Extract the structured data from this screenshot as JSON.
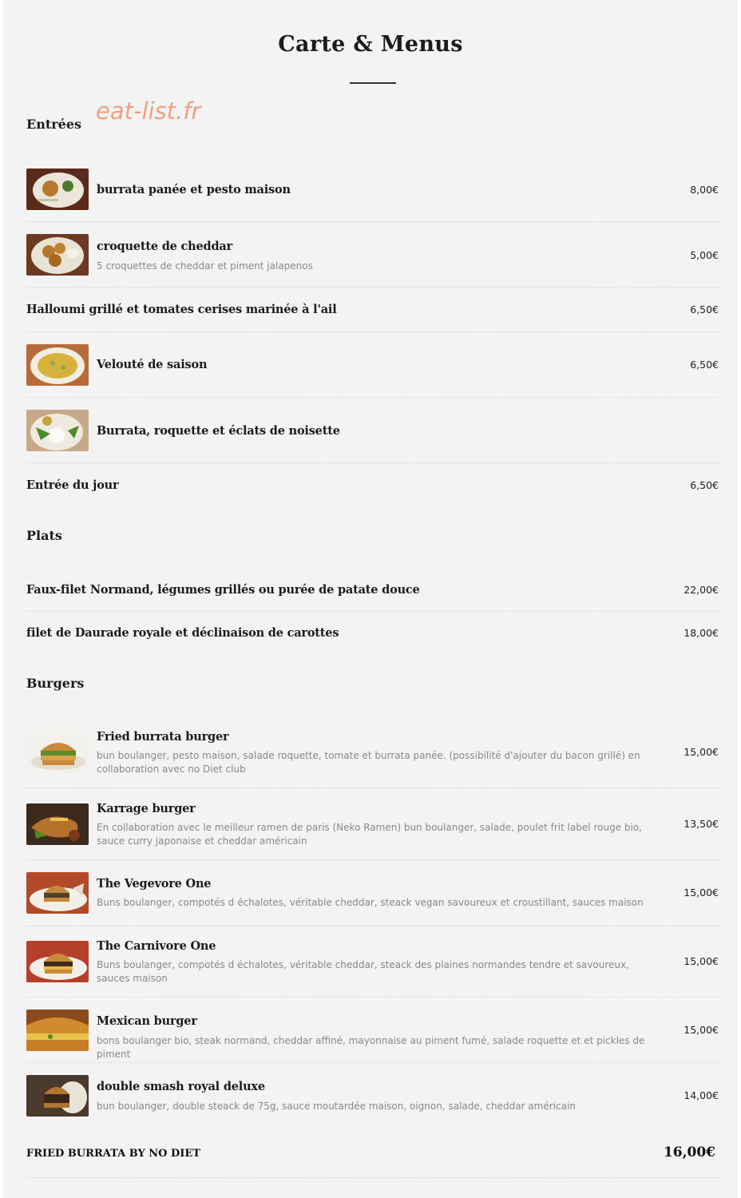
{
  "header": {
    "title": "Carte & Menus",
    "watermark": "eat-list.fr"
  },
  "sections": {
    "entrees": {
      "title": "Entrées",
      "items": [
        {
          "name": "burrata panée et pesto maison",
          "price": "8,00€",
          "image": "burrata-pesto-photo"
        },
        {
          "name": "croquette de cheddar",
          "description": "5 croquettes de cheddar et piment jalapenos",
          "price": "5,00€",
          "image": "cheddar-croquettes-photo"
        },
        {
          "name": "Halloumi grillé et tomates cerises marinée à l'ail",
          "price": "6,50€"
        },
        {
          "name": "Velouté de saison",
          "price": "6,50€",
          "image": "veloute-soup-photo"
        },
        {
          "name": "Burrata, roquette et éclats de noisette",
          "price": "",
          "image": "burrata-roquette-photo"
        },
        {
          "name": "Entrée du jour",
          "price": "6,50€"
        }
      ]
    },
    "plats": {
      "title": "Plats",
      "items": [
        {
          "name": "Faux-filet Normand, légumes grillés ou purée de patate douce",
          "price": "22,00€"
        },
        {
          "name": "filet de Daurade royale et déclinaison de carottes",
          "price": "18,00€"
        }
      ]
    },
    "burgers": {
      "title": "Burgers",
      "items": [
        {
          "name": "Fried burrata burger",
          "description": "bun boulanger, pesto maison, salade roquette, tomate et burrata panée. (possibilité d'ajouter du bacon grillé) en collaboration avec no Diet club",
          "price": "15,00€",
          "image": "fried-burrata-burger-photo"
        },
        {
          "name": "Karrage burger",
          "description": "En collaboration avec le meilleur ramen de paris (Neko Ramen) bun boulanger, salade, poulet frit label rouge bio, sauce curry japonaise et cheddar américain",
          "price": "13,50€",
          "image": "karrage-burger-photo"
        },
        {
          "name": "The Vegevore One",
          "description": "Buns boulanger, compotés d échalotes, véritable cheddar, steack vegan savoureux et croustillant, sauces maison",
          "price": "15,00€",
          "image": "vegevore-burger-photo"
        },
        {
          "name": "The Carnivore One",
          "description": "Buns boulanger, compotés d échalotes, véritable cheddar, steack des plaines normandes tendre et savoureux, sauces maison",
          "price": "15,00€",
          "image": "carnivore-burger-photo"
        },
        {
          "name": "Mexican burger",
          "description": "bons boulanger bio, steak normand, cheddar affiné, mayonnaise au piment fumé, salade roquette et et pickles de piment",
          "price": "15,00€",
          "image": "mexican-burger-photo"
        },
        {
          "name": "double smash royal deluxe",
          "description": "bun boulanger, double steack de 75g, sauce moutardée maison, oignon, salade, cheddar américain",
          "price": "14,00€",
          "image": "double-smash-burger-photo"
        }
      ]
    }
  },
  "final": {
    "name": "FRIED BURRATA BY NO DIET",
    "price": "16,00€"
  },
  "colors": {
    "background": "#f3f3f3",
    "text": "#1b1b1b",
    "muted": "#888888",
    "watermark": "#f0a07e"
  }
}
